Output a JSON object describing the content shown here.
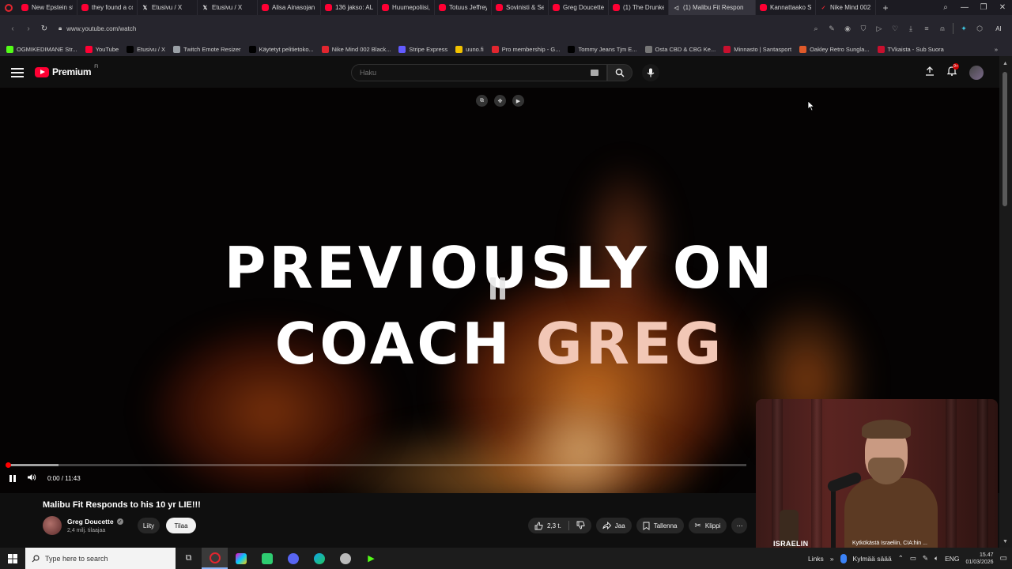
{
  "browser": {
    "tabs": [
      {
        "label": "New Epstein st",
        "icon": "yt"
      },
      {
        "label": "they found a cc",
        "icon": "yt"
      },
      {
        "label": "Etusivu / X",
        "icon": "x"
      },
      {
        "label": "Etusivu / X",
        "icon": "x"
      },
      {
        "label": "Alisa Ainasojan",
        "icon": "yt"
      },
      {
        "label": "136 jakso: ALI K",
        "icon": "yt"
      },
      {
        "label": "Huumepoliisi, F",
        "icon": "yt"
      },
      {
        "label": "Totuus Jeffrey E",
        "icon": "yt"
      },
      {
        "label": "Sovinisti & Seis",
        "icon": "yt"
      },
      {
        "label": "Greg Doucette",
        "icon": "yt"
      },
      {
        "label": "(1) The Drunker",
        "icon": "yt"
      },
      {
        "label": "(1) Malibu Fit Respon",
        "icon": "mute",
        "active": true
      },
      {
        "label": "Kannattaako Sc",
        "icon": "yt"
      },
      {
        "label": "Nike Mind 002",
        "icon": "nike"
      }
    ],
    "url": "www.youtube.com/watch",
    "ai_label": "AI",
    "bookmarks": [
      {
        "label": "OGMIKEDIMANE Str...",
        "color": "#53fc18"
      },
      {
        "label": "YouTube",
        "color": "#ff0033"
      },
      {
        "label": "Etusivu / X",
        "color": "#000000"
      },
      {
        "label": "Twitch Emote Resizer",
        "color": "#9aa0a6"
      },
      {
        "label": "Käytetyt pelitietoko...",
        "color": "#000000"
      },
      {
        "label": "Nike Mind 002 Black...",
        "color": "#e2262f"
      },
      {
        "label": "Stripe Express",
        "color": "#635bff"
      },
      {
        "label": "uuno.fi",
        "color": "#f2c200"
      },
      {
        "label": "Pro membership - G...",
        "color": "#e2262f"
      },
      {
        "label": "Tommy Jeans Tjm E...",
        "color": "#000000"
      },
      {
        "label": "Osta CBD & CBG Ke...",
        "color": "#777777"
      },
      {
        "label": "Minnasto | Santasport",
        "color": "#c8102e"
      },
      {
        "label": "Oakley Retro Sungla...",
        "color": "#e05a2a"
      },
      {
        "label": "TVkaista - Sub Suora",
        "color": "#c8102e"
      }
    ]
  },
  "youtube": {
    "logo_text": "Premium",
    "country_code": "FI",
    "search_placeholder": "Haku",
    "notification_count": "9+"
  },
  "video": {
    "overlay_line1": "PREVIOUSLY ON",
    "overlay_line2a": "COACH ",
    "overlay_line2b": "GREG",
    "time_display": "0:00 / 11:43",
    "progress_fraction": 0.002,
    "buffer_fraction": 0.07
  },
  "webcam": {
    "label": "ISRAELIN",
    "news_text": "Kytkökästä Israeliin, CIA:hin ..."
  },
  "info": {
    "title": "Malibu Fit Responds to his 10 yr LIE!!!",
    "channel_name": "Greg Doucette",
    "subscribers": "2,4 milj. tilaajaa",
    "join_label": "Liity",
    "subscribe_label": "Tilaa",
    "likes": "2,3 t.",
    "share_label": "Jaa",
    "save_label": "Tallenna",
    "clip_label": "Klippi"
  },
  "taskbar": {
    "search_placeholder": "Type here to search",
    "links_label": "Links",
    "weather": "Kylmää säää",
    "language": "ENG",
    "time": "15.47",
    "date": "01/03/2026"
  },
  "colors": {
    "brand_red": "#ff0033",
    "progress_red": "#ff0000",
    "background": "#0f0f0f"
  }
}
